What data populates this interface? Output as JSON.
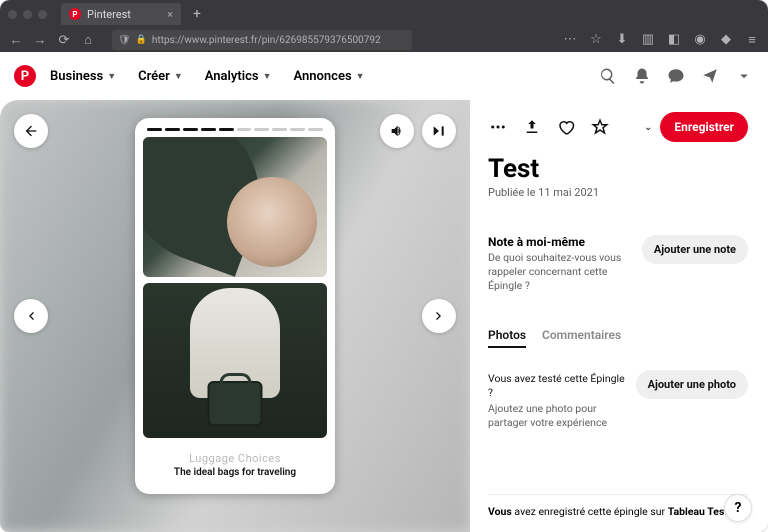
{
  "browser": {
    "tab_title": "Pinterest",
    "url": "https://www.pinterest.fr/pin/626985579376500792"
  },
  "topnav": {
    "business": "Business",
    "create": "Créer",
    "analytics": "Analytics",
    "ads": "Annonces"
  },
  "pin": {
    "card_title": "Luggage Choices",
    "card_subtitle": "The ideal bags for traveling"
  },
  "panel": {
    "save_button": "Enregistrer",
    "title": "Test",
    "published": "Publiée le 11 mai 2021",
    "note_title": "Note à moi-même",
    "note_body": "De quoi souhaitez-vous vous rappeler concernant cette Épingle ?",
    "add_note_btn": "Ajouter une note",
    "tabs": {
      "photos": "Photos",
      "comments": "Commentaires"
    },
    "tried_title": "Vous avez testé cette Épingle ?",
    "tried_body": "Ajoutez une photo pour partager votre expérience",
    "add_photo_btn": "Ajouter une photo",
    "footer_prefix_bold": "Vous",
    "footer_rest": " avez enregistré cette épingle sur ",
    "footer_board_bold": "Tableau Test",
    "help": "?"
  }
}
